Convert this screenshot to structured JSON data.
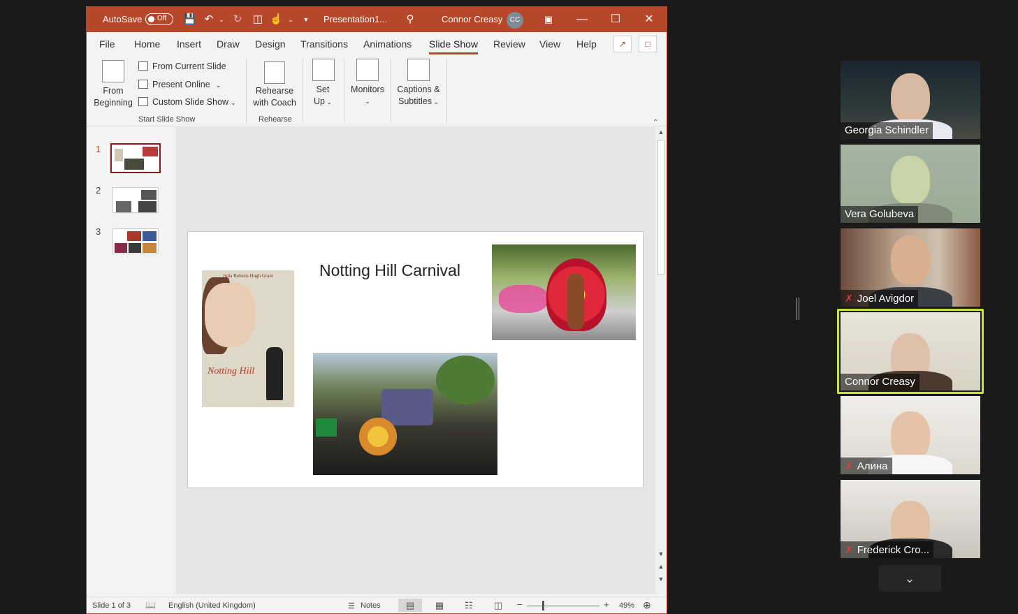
{
  "titlebar": {
    "autosave_label": "AutoSave",
    "autosave_state": "Off",
    "doc_title": "Presentation1...",
    "user_name": "Connor Creasy",
    "user_initials": "CC",
    "accent_color": "#b7472a"
  },
  "tabs": [
    "File",
    "Home",
    "Insert",
    "Draw",
    "Design",
    "Transitions",
    "Animations",
    "Slide Show",
    "Review",
    "View",
    "Help"
  ],
  "active_tab": "Slide Show",
  "ribbon": {
    "from_beginning": [
      "From",
      "Beginning"
    ],
    "from_current": "From Current Slide",
    "present_online": "Present Online",
    "custom_show": "Custom Slide Show",
    "group_start": "Start Slide Show",
    "rehearse": [
      "Rehearse",
      "with Coach"
    ],
    "group_rehearse": "Rehearse",
    "setup": [
      "Set",
      "Up"
    ],
    "monitors": "Monitors",
    "captions": [
      "Captions &",
      "Subtitles"
    ]
  },
  "thumbnails": [
    "1",
    "2",
    "3"
  ],
  "selected_slide": "1",
  "slide": {
    "title": "Notting Hill Carnival",
    "poster_actors": "Julia Roberts     Hugh Grant",
    "poster_title": "Notting Hill"
  },
  "status": {
    "slide_counter": "Slide 1 of 3",
    "language": "English (United Kingdom)",
    "notes": "Notes",
    "zoom": "49%"
  },
  "participants": [
    {
      "name": "Georgia Schindler",
      "muted": false
    },
    {
      "name": "Vera Golubeva",
      "muted": false
    },
    {
      "name": "Joel Avigdor",
      "muted": true
    },
    {
      "name": "Connor Creasy",
      "muted": false,
      "speaking": true
    },
    {
      "name": "Алина",
      "muted": true
    },
    {
      "name": "Frederick Cro...",
      "muted": true
    }
  ],
  "icons": {
    "save": "save-icon",
    "undo": "undo-icon",
    "redo": "redo-icon",
    "search": "search-icon",
    "share": "share-icon",
    "comments": "comments-icon",
    "mic_muted": "mic-muted-icon",
    "chevron": "chevron-down-icon"
  }
}
